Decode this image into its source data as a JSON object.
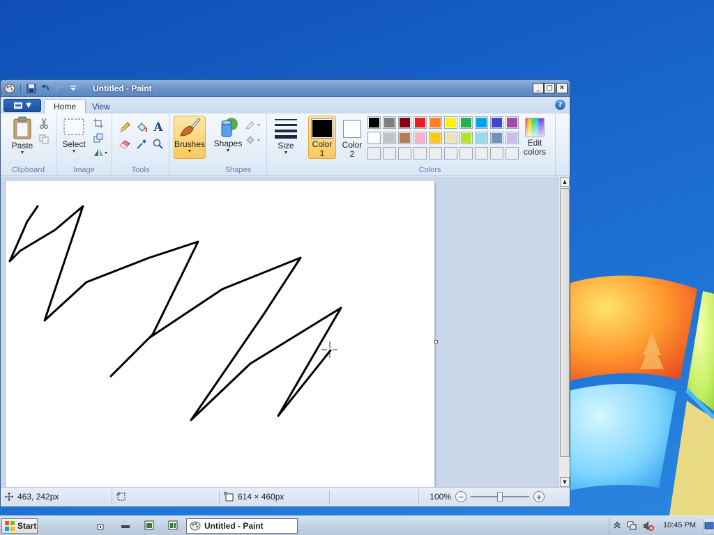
{
  "window": {
    "title": "Untitled - Paint",
    "controls": {
      "minimize": "_",
      "maximize": "□",
      "close": "✕"
    }
  },
  "ribbon": {
    "tabs": [
      {
        "label": "Home",
        "active": true
      },
      {
        "label": "View",
        "active": false
      }
    ],
    "clipboard": {
      "paste_label": "Paste",
      "group_label": "Clipboard"
    },
    "image": {
      "select_label": "Select",
      "group_label": "Image"
    },
    "tools": {
      "group_label": "Tools",
      "text_tool_glyph": "A"
    },
    "brushes": {
      "label": "Brushes"
    },
    "shapes": {
      "label": "Shapes",
      "group_label": "Shapes"
    },
    "size": {
      "label": "Size"
    },
    "color1": {
      "label_line1": "Color",
      "label_line2": "1",
      "value": "#000000"
    },
    "color2": {
      "label_line1": "Color",
      "label_line2": "2",
      "value": "#ffffff"
    },
    "colors": {
      "group_label": "Colors",
      "edit_line1": "Edit",
      "edit_line2": "colors",
      "palette_row1": [
        "#000000",
        "#7f7f7f",
        "#880015",
        "#ed1c24",
        "#ff7f27",
        "#fff200",
        "#22b14c",
        "#00a2e8",
        "#3f48cc",
        "#a349a4"
      ],
      "palette_row2": [
        "#ffffff",
        "#c3c3c3",
        "#b97a57",
        "#ffaec9",
        "#ffc90e",
        "#efe4b0",
        "#b5e61d",
        "#99d9ea",
        "#7092be",
        "#c8bfe7"
      ],
      "palette_row3": [
        "#eeeeee",
        "#eeeeee",
        "#eeeeee",
        "#eeeeee",
        "#eeeeee",
        "#eeeeee",
        "#eeeeee",
        "#eeeeee",
        "#eeeeee",
        "#eeeeee"
      ]
    },
    "help_glyph": "?"
  },
  "status": {
    "cursor_pos": "463, 242px",
    "canvas_size": "614 × 460px",
    "zoom": "100%",
    "zoom_level_fraction": 0.5
  },
  "taskbar": {
    "start_label": "Start",
    "app_label": "Untitled - Paint",
    "clock": "10:45 PM"
  }
}
